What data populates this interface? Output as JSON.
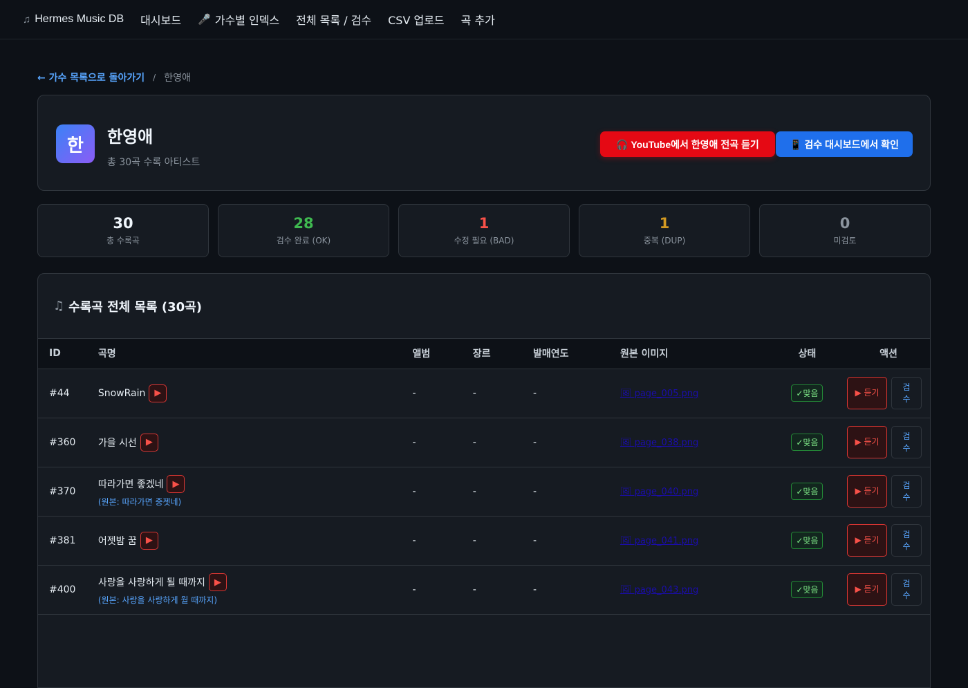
{
  "nav": {
    "brand": "Hermes Music DB",
    "brand_icon": "music-note-icon",
    "dashboard": "대시보드",
    "artist_index": "가수별 인덱스",
    "artist_index_icon": "microphone-icon",
    "list_review": "전체 목록 / 검수",
    "csv_upload": "CSV 업로드",
    "add_song": "곡 추가"
  },
  "breadcrumb": {
    "back": "← 가수 목록으로 돌아가기",
    "separator": "/",
    "current": "한영애"
  },
  "artist": {
    "avatar": "한",
    "name": "한영애",
    "subtitle": "총 30곡 수록 아티스트",
    "youtube_button": "🎧 YouTube에서 한영애 전곡 듣기",
    "review_button": "📱 검수 대시보드에서 확인"
  },
  "stats": [
    {
      "value": "30",
      "label": "총 수록곡",
      "color": "#f0f6fc"
    },
    {
      "value": "28",
      "label": "검수 완료 (OK)",
      "color": "#3fb950"
    },
    {
      "value": "1",
      "label": "수정 필요 (BAD)",
      "color": "#f85149"
    },
    {
      "value": "1",
      "label": "중복 (DUP)",
      "color": "#d29922"
    },
    {
      "value": "0",
      "label": "미검토",
      "color": "#8b949e"
    }
  ],
  "songs": {
    "title": "수록곡 전체 목록 (30곡)",
    "title_icon": "music-note-icon",
    "columns": {
      "id": "ID",
      "title": "곡명",
      "album": "앨범",
      "genre": "장르",
      "year": "발매연도",
      "image": "원본 이미지",
      "status": "상태",
      "action": "액션"
    },
    "listen_label": "▶ 듣기",
    "check_label": "검수",
    "rows": [
      {
        "id": "#44",
        "title": "SnowRain",
        "original": "",
        "album": "-",
        "genre": "-",
        "year": "-",
        "image": "🖼 page_005.png",
        "status": "✓맞음"
      },
      {
        "id": "#360",
        "title": "가을 시선",
        "original": "",
        "album": "-",
        "genre": "-",
        "year": "-",
        "image": "🖼 page_038.png",
        "status": "✓맞음"
      },
      {
        "id": "#370",
        "title": "따라가면 좋겠네",
        "original": "(원본: 따라가면 중젯네)",
        "album": "-",
        "genre": "-",
        "year": "-",
        "image": "🖼 page_040.png",
        "status": "✓맞음"
      },
      {
        "id": "#381",
        "title": "어젯밤 꿈",
        "original": "",
        "album": "-",
        "genre": "-",
        "year": "-",
        "image": "🖼 page_041.png",
        "status": "✓맞음"
      },
      {
        "id": "#400",
        "title": "사랑을 사랑하게 될 때까지",
        "original": "(원본: 사랑을 사랑하게 월 때까지)",
        "album": "-",
        "genre": "-",
        "year": "-",
        "image": "🖼 page_043.png",
        "status": "✓맞음"
      }
    ]
  }
}
